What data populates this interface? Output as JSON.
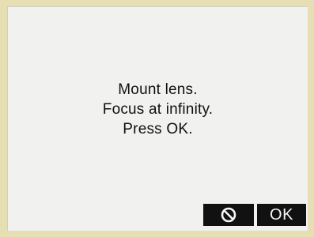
{
  "dialog": {
    "lines": [
      "Mount lens.",
      "Focus at infinity.",
      "Press OK."
    ]
  },
  "softkeys": {
    "cancel_icon": "cancel-icon",
    "ok_label": "OK"
  },
  "colors": {
    "screen_background": "#f1f1ef",
    "bezel": "#e6dfb4",
    "key_background": "#111111",
    "key_foreground": "#f5f5f5",
    "text": "#111111"
  }
}
